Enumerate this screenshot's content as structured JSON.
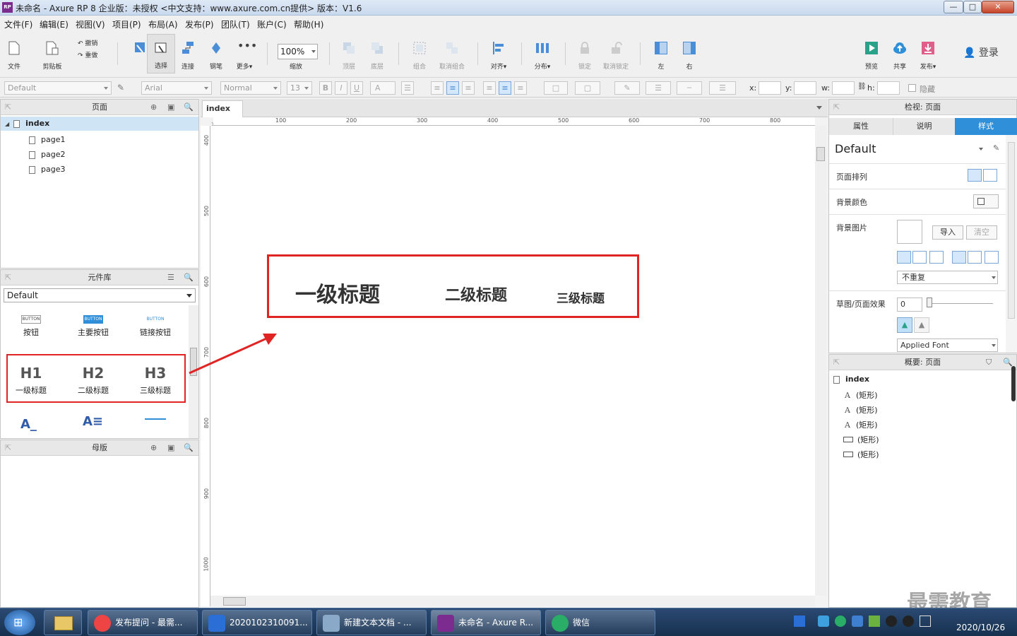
{
  "window": {
    "title": "未命名 - Axure RP 8 企业版：未授权    <中文支持：www.axure.com.cn提供> 版本：V1.6",
    "app_icon": "RP",
    "minimize": "—",
    "maximize": "□",
    "close": "✕"
  },
  "menu": [
    "文件(F)",
    "编辑(E)",
    "视图(V)",
    "项目(P)",
    "布局(A)",
    "发布(P)",
    "团队(T)",
    "账户(C)",
    "帮助(H)"
  ],
  "toolbar": {
    "file": "文件",
    "clipboard": "剪贴板",
    "undo": "撤销",
    "redo": "重做",
    "select": "选择",
    "connect": "连接",
    "pen": "钢笔",
    "more": "更多▾",
    "zoom_value": "100%",
    "zoom_label": "缩放",
    "top": "顶层",
    "bottom": "底层",
    "group": "组合",
    "ungroup": "取消组合",
    "align": "对齐▾",
    "distribute": "分布▾",
    "lock": "锁定",
    "unlock": "取消锁定",
    "left": "左",
    "right": "右",
    "preview": "预览",
    "share": "共享",
    "publish": "发布▾",
    "login": "登录"
  },
  "formatbar": {
    "style": "Default",
    "font": "Arial",
    "weight": "Normal",
    "size": "13",
    "bold": "B",
    "italic": "I",
    "underline": "U",
    "font_color": "A",
    "x_label": "x:",
    "y_label": "y:",
    "w_label": "w:",
    "h_label": "h:",
    "hidden_label": "隐藏"
  },
  "pages_panel": {
    "title": "页面",
    "root": "index",
    "pages": [
      "page1",
      "page2",
      "page3"
    ]
  },
  "library_panel": {
    "title": "元件库",
    "selected": "Default",
    "widgets_row1": [
      {
        "preview": "BUTTON",
        "label": "按钮"
      },
      {
        "preview": "BUTTON",
        "label": "主要按钮"
      },
      {
        "preview": "BUTTON",
        "label": "链接按钮"
      }
    ],
    "widgets_row2": [
      {
        "preview": "H1",
        "label": "一级标题"
      },
      {
        "preview": "H2",
        "label": "二级标题"
      },
      {
        "preview": "H3",
        "label": "三级标题"
      }
    ]
  },
  "masters_panel": {
    "title": "母版"
  },
  "canvas": {
    "tab": "index",
    "tab_close": "×",
    "ruler_h": [
      "100",
      "200",
      "300",
      "400",
      "500",
      "600",
      "700",
      "800"
    ],
    "ruler_v": [
      "400",
      "500",
      "600",
      "700",
      "800",
      "900",
      "1000"
    ],
    "headings": {
      "h1": "一级标题",
      "h2": "二级标题",
      "h3": "三级标题"
    }
  },
  "inspector": {
    "title": "检视: 页面",
    "tabs": [
      "属性",
      "说明",
      "样式"
    ],
    "active_tab": 2,
    "style_name": "Default",
    "page_align": "页面排列",
    "bg_color": "背景颜色",
    "bg_image": "背景图片",
    "import": "导入",
    "clear": "清空",
    "repeat": "不重复",
    "sketch": "草图/页面效果",
    "sketch_value": "0",
    "font": "Applied Font"
  },
  "outline": {
    "title": "概要: 页面",
    "root": "index",
    "items": [
      "(矩形)",
      "(矩形)",
      "(矩形)",
      "(矩形)",
      "(矩形)"
    ],
    "item_icons": [
      "text",
      "text",
      "text",
      "rect",
      "rect"
    ]
  },
  "taskbar": {
    "tasks": [
      {
        "label": "发布提问 - 最需...",
        "color": "#e44"
      },
      {
        "label": "2020102310091...",
        "color": "#2b6fd6"
      },
      {
        "label": "新建文本文档 - ...",
        "color": "#8aa9c8"
      },
      {
        "label": "未命名 - Axure R...",
        "color": "#7b2c8e"
      },
      {
        "label": "微信",
        "color": "#2aae67"
      }
    ],
    "time": "2020/10/26",
    "watermark": "最需教育"
  },
  "colors": {
    "highlight_red": "#e02424",
    "accent_blue": "#2f8fd8",
    "selected_tab": "#2f8fd8"
  }
}
